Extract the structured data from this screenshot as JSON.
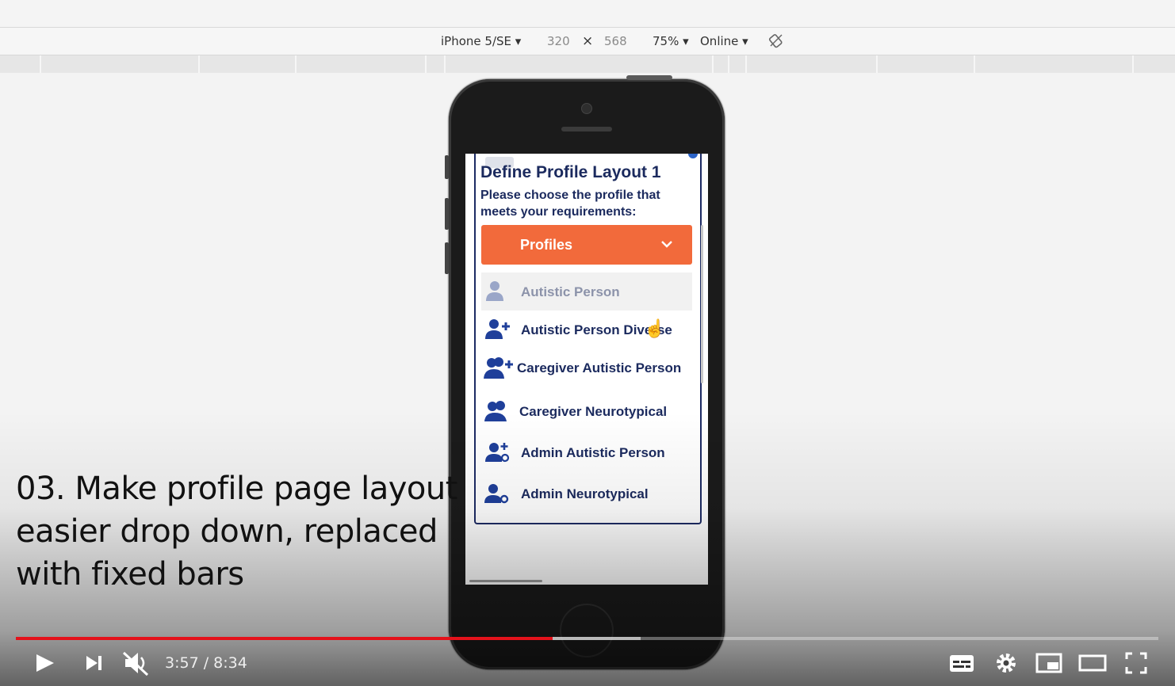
{
  "devtools": {
    "device": "iPhone 5/SE",
    "width": "320",
    "times": "×",
    "height": "568",
    "zoom": "75%",
    "network": "Online",
    "rotate_icon": "rotate-icon"
  },
  "app": {
    "title": "Define Profile Layout 1",
    "subtitle": "Please choose the profile that meets your requirements:",
    "dropdown_label": "Profiles",
    "items": [
      {
        "label": "Autistic Person",
        "icon": "user-icon"
      },
      {
        "label": "Autistic Person Diverse",
        "icon": "user-plus-icon"
      },
      {
        "label": "Caregiver Autistic Person",
        "icon": "users-plus-icon"
      },
      {
        "label": "Caregiver Neurotypical",
        "icon": "users-icon"
      },
      {
        "label": "Admin Autistic Person",
        "icon": "admin-plus-icon"
      },
      {
        "label": "Admin Neurotypical",
        "icon": "admin-gear-icon"
      }
    ],
    "accent_color": "#f26a3b",
    "text_color": "#1b2a5e"
  },
  "caption": "03. Make profile page layout easier drop down, replaced with fixed bars",
  "player": {
    "current_time": "3:57",
    "separator": " / ",
    "duration": "8:34",
    "played_fraction": 0.47,
    "buffered_fraction": 0.547,
    "progress_color": "#e4121b"
  }
}
